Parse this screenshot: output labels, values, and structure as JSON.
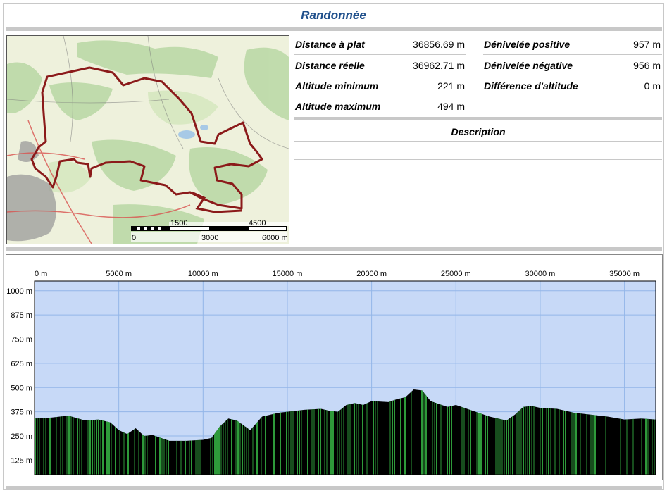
{
  "title": "Randonnée",
  "stats": {
    "left": [
      {
        "label": "Distance à plat",
        "value": "36856.69 m"
      },
      {
        "label": "Distance réelle",
        "value": "36962.71 m"
      },
      {
        "label": "Altitude minimum",
        "value": "221 m"
      },
      {
        "label": "Altitude maximum",
        "value": "494 m"
      }
    ],
    "right": [
      {
        "label": "Dénivelée positive",
        "value": "957 m"
      },
      {
        "label": "Dénivelée négative",
        "value": "956 m"
      },
      {
        "label": "Différence d'altitude",
        "value": "0 m"
      }
    ]
  },
  "description": {
    "title": "Description",
    "text": ""
  },
  "map": {
    "scale_top_labels": [
      "1500",
      "4500"
    ],
    "scale_bottom_labels": [
      "0",
      "3000",
      "6000 m"
    ],
    "route_color": "#8b1a1a"
  },
  "chart_data": {
    "type": "area",
    "xlabel": "",
    "ylabel": "",
    "x_ticks": [
      "0 m",
      "5000 m",
      "10000 m",
      "15000 m",
      "20000 m",
      "25000 m",
      "30000 m",
      "35000 m"
    ],
    "y_ticks": [
      "1000 m",
      "875 m",
      "750 m",
      "625 m",
      "500 m",
      "375 m",
      "250 m",
      "125 m"
    ],
    "xlim": [
      0,
      36856
    ],
    "ylim": [
      50,
      1050
    ],
    "x": [
      0,
      1000,
      2000,
      3000,
      3800,
      4500,
      5000,
      5500,
      6000,
      6500,
      7000,
      7500,
      8000,
      9000,
      10000,
      10500,
      11000,
      11500,
      12000,
      12800,
      13500,
      14000,
      14500,
      15000,
      16000,
      17000,
      17500,
      18000,
      18500,
      19000,
      19500,
      20000,
      21000,
      21500,
      22000,
      22500,
      23000,
      23500,
      24000,
      24500,
      25000,
      26000,
      27000,
      28000,
      28500,
      29000,
      29500,
      30000,
      31000,
      32000,
      33000,
      34000,
      35000,
      36000,
      36856
    ],
    "series": [
      {
        "values": [
          340,
          345,
          355,
          330,
          335,
          320,
          280,
          260,
          290,
          250,
          255,
          240,
          225,
          225,
          230,
          240,
          300,
          340,
          330,
          280,
          350,
          360,
          370,
          375,
          385,
          390,
          380,
          375,
          410,
          420,
          410,
          430,
          425,
          440,
          450,
          490,
          485,
          430,
          415,
          400,
          410,
          380,
          350,
          330,
          360,
          400,
          405,
          395,
          390,
          370,
          360,
          350,
          335,
          340,
          335
        ]
      }
    ],
    "colors": {
      "sky": "#c7d9f7",
      "ground": "#000000",
      "strip": "#2e9a3a",
      "grid": "#93b6e8"
    }
  }
}
